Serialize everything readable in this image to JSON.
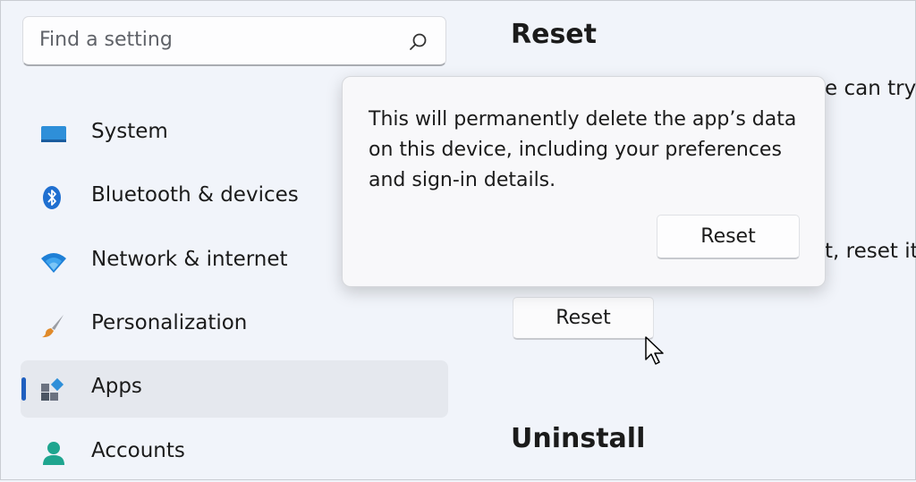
{
  "search": {
    "placeholder": "Find a setting",
    "icon": "search-icon"
  },
  "sidebar": {
    "items": [
      {
        "label": "System",
        "icon": "monitor-icon",
        "selected": false
      },
      {
        "label": "Bluetooth & devices",
        "icon": "bluetooth-icon",
        "selected": false
      },
      {
        "label": "Network & internet",
        "icon": "wifi-icon",
        "selected": false
      },
      {
        "label": "Personalization",
        "icon": "paintbrush-icon",
        "selected": false
      },
      {
        "label": "Apps",
        "icon": "apps-icon",
        "selected": true
      },
      {
        "label": "Accounts",
        "icon": "person-icon",
        "selected": false
      }
    ]
  },
  "main": {
    "reset_heading": "Reset",
    "partial_text_1": "e can try t",
    "partial_text_2": "t, reset it.",
    "reset_button": "Reset",
    "uninstall_heading": "Uninstall"
  },
  "flyout": {
    "message": "This will permanently delete the app’s data on this device, including your preferences and sign-in details.",
    "confirm_button": "Reset"
  },
  "colors": {
    "accent": "#1f5fbf",
    "background": "#f1f4fa",
    "selected_item": "#e5e8ee"
  }
}
